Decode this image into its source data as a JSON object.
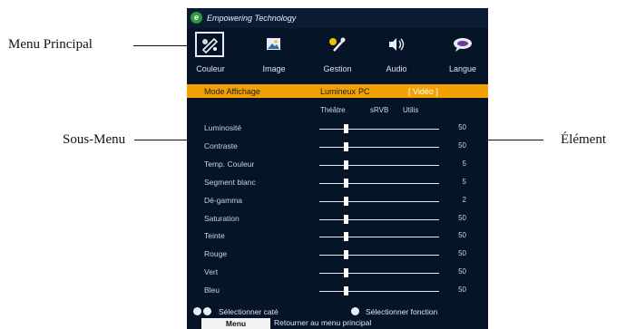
{
  "callouts": {
    "menu_principal": "Menu Principal",
    "sous_menu": "Sous-Menu",
    "element": "Élément"
  },
  "osd": {
    "brand": "Empowering Technology",
    "logo_letter": "e",
    "tabs": [
      {
        "label": "Couleur",
        "icon": "palette-icon",
        "selected": true
      },
      {
        "label": "Image",
        "icon": "picture-icon",
        "selected": false
      },
      {
        "label": "Gestion",
        "icon": "tools-icon",
        "selected": false
      },
      {
        "label": "Audio",
        "icon": "speaker-icon",
        "selected": false
      },
      {
        "label": "Langue",
        "icon": "language-icon",
        "selected": false
      }
    ],
    "mode": {
      "label": "Mode Affichage",
      "options": [
        "Lumineux",
        "PC",
        "[ Vidéo ]"
      ],
      "sub_options": [
        "Théâtre",
        "sRVB",
        "Utilis"
      ]
    },
    "items": [
      {
        "label": "Luminosité",
        "value": "50",
        "level": 0.22
      },
      {
        "label": "Contraste",
        "value": "50",
        "level": 0.22
      },
      {
        "label": "Temp. Couleur",
        "value": "5",
        "level": 0.22
      },
      {
        "label": "Segment blanc",
        "value": "5",
        "level": 0.22
      },
      {
        "label": "Dé-gamma",
        "value": "2",
        "level": 0.22
      },
      {
        "label": "Saturation",
        "value": "50",
        "level": 0.22
      },
      {
        "label": "Teinte",
        "value": "50",
        "level": 0.22
      },
      {
        "label": "Rouge",
        "value": "50",
        "level": 0.22
      },
      {
        "label": "Vert",
        "value": "50",
        "level": 0.22
      },
      {
        "label": "Bleu",
        "value": "50",
        "level": 0.22
      }
    ],
    "footer": {
      "select_category": "Sélectionner caté",
      "select_function": "Sélectionner fonction",
      "menu_button": "Menu",
      "return_text": "Retourner au menu principal"
    },
    "colors": {
      "accent": "#f2a100",
      "background": "#061428"
    }
  }
}
